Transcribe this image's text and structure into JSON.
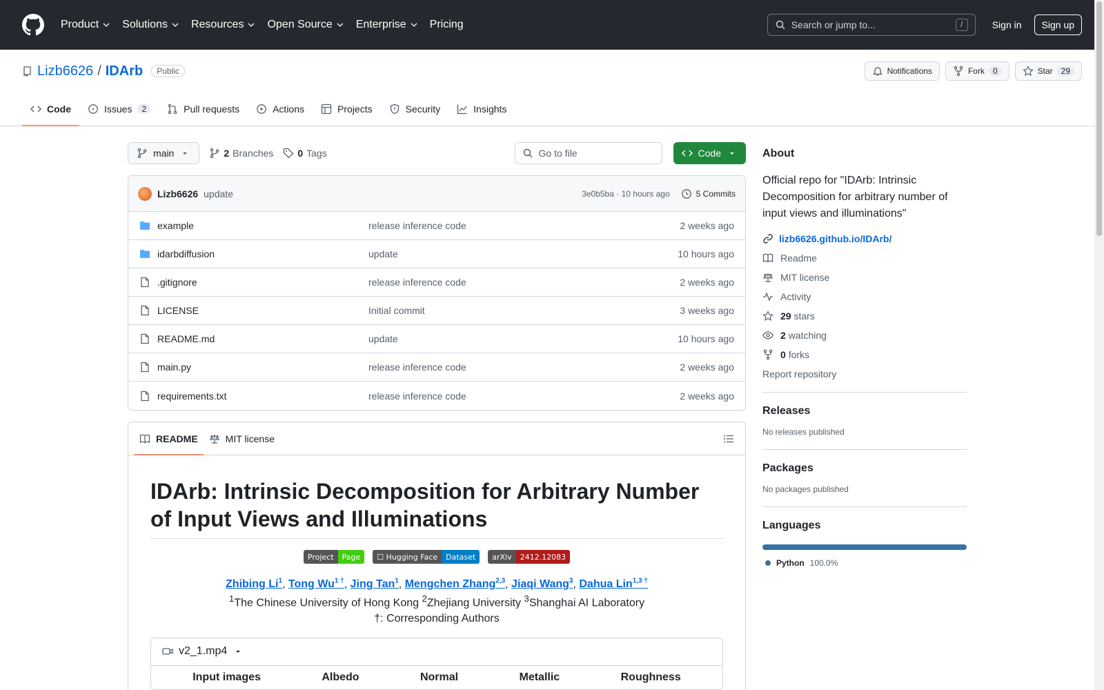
{
  "header": {
    "nav": [
      "Product",
      "Solutions",
      "Resources",
      "Open Source",
      "Enterprise",
      "Pricing"
    ],
    "search_placeholder": "Search or jump to...",
    "search_shortcut": "/",
    "signin": "Sign in",
    "signup": "Sign up"
  },
  "repo": {
    "owner": "Lizb6626",
    "separator": "/",
    "name": "IDArb",
    "visibility": "Public",
    "notifications": "Notifications",
    "fork_label": "Fork",
    "fork_count": "0",
    "star_label": "Star",
    "star_count": "29"
  },
  "tabs": {
    "code": "Code",
    "issues": "Issues",
    "issues_count": "2",
    "pulls": "Pull requests",
    "actions": "Actions",
    "projects": "Projects",
    "security": "Security",
    "insights": "Insights"
  },
  "toolbar": {
    "branch": "main",
    "branches_count": "2",
    "branches_label": "Branches",
    "tags_count": "0",
    "tags_label": "Tags",
    "gofile_placeholder": "Go to file",
    "code_button": "Code"
  },
  "commit": {
    "author": "Lizb6626",
    "message": "update",
    "hash": "3e0b5ba",
    "dot": "·",
    "time": "10 hours ago",
    "commits": "5 Commits"
  },
  "files": [
    {
      "name": "example",
      "type": "dir",
      "message": "release inference code",
      "date": "2 weeks ago"
    },
    {
      "name": "idarbdiffusion",
      "type": "dir",
      "message": "update",
      "date": "10 hours ago"
    },
    {
      "name": ".gitignore",
      "type": "file",
      "message": "release inference code",
      "date": "2 weeks ago"
    },
    {
      "name": "LICENSE",
      "type": "file",
      "message": "Initial commit",
      "date": "3 weeks ago"
    },
    {
      "name": "README.md",
      "type": "file",
      "message": "update",
      "date": "10 hours ago"
    },
    {
      "name": "main.py",
      "type": "file",
      "message": "release inference code",
      "date": "2 weeks ago"
    },
    {
      "name": "requirements.txt",
      "type": "file",
      "message": "release inference code",
      "date": "2 weeks ago"
    }
  ],
  "readme": {
    "tab_readme": "README",
    "tab_license": "MIT license",
    "title": "IDArb: Intrinsic Decomposition for Arbitrary Number of Input Views and Illuminations",
    "badges": [
      {
        "left": "Project",
        "right": "Page",
        "color": "#4c1"
      },
      {
        "left": "☐ Hugging Face",
        "right": "Dataset",
        "color": "#007ec6"
      },
      {
        "left": "arXiv",
        "right": "2412.12083",
        "color": "#b31b1b"
      }
    ],
    "authors": [
      {
        "name": "Zhibing Li",
        "sup": "1"
      },
      {
        "name": "Tong Wu",
        "sup": "1 †"
      },
      {
        "name": "Jing Tan",
        "sup": "1"
      },
      {
        "name": "Mengchen Zhang",
        "sup": "2,3"
      },
      {
        "name": "Jiaqi Wang",
        "sup": "3"
      },
      {
        "name": "Dahua Lin",
        "sup": "1,3 †"
      }
    ],
    "affil_1_sup": "1",
    "affil_1": "The Chinese University of Hong Kong ",
    "affil_2_sup": "2",
    "affil_2": "Zhejiang University ",
    "affil_3_sup": "3",
    "affil_3": "Shanghai AI Laboratory",
    "corresponding": "†: Corresponding Authors",
    "video_file": "v2_1.mp4",
    "video_columns": [
      "Input images",
      "Albedo",
      "Normal",
      "Metallic",
      "Roughness"
    ]
  },
  "sidebar": {
    "about_title": "About",
    "description": "Official repo for \"IDArb: Intrinsic Decomposition for arbitrary number of input views and illuminations\"",
    "homepage": "lizb6626.github.io/IDArb/",
    "readme": "Readme",
    "license": "MIT license",
    "activity": "Activity",
    "stars_count": "29",
    "stars_label": "stars",
    "watching_count": "2",
    "watching_label": "watching",
    "forks_count": "0",
    "forks_label": "forks",
    "report": "Report repository",
    "releases_title": "Releases",
    "releases_empty": "No releases published",
    "packages_title": "Packages",
    "packages_empty": "No packages published",
    "languages_title": "Languages",
    "language": "Python",
    "language_pct": "100.0%",
    "language_color": "#3572A5"
  }
}
